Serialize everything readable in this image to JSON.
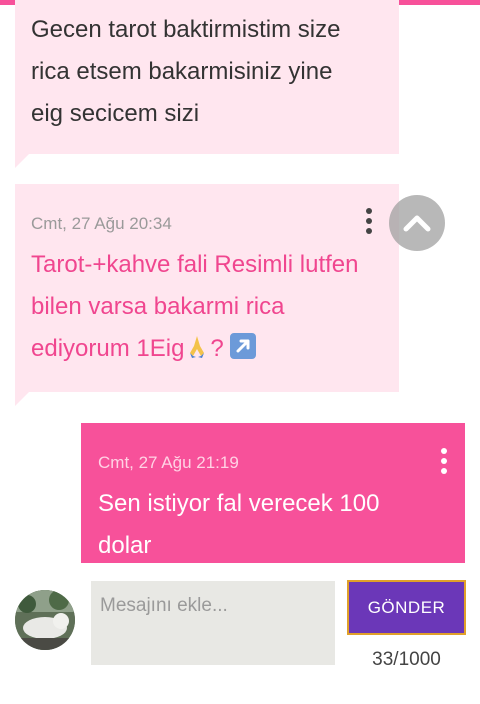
{
  "colors": {
    "accent": "#f7519a",
    "incoming_bg": "#ffe6ef",
    "send_button": "#6b37b8",
    "send_border": "#e0a02a"
  },
  "messages": [
    {
      "direction": "incoming",
      "text_lines": [
        "Gecen tarot baktirmistim size",
        "rica etsem bakarmisiniz yine",
        "eig secicem sizi"
      ]
    },
    {
      "direction": "incoming",
      "timestamp": "Cmt, 27 Ağu 20:34",
      "text_lines": [
        "Tarot-+kahve fali Resimli lutfen",
        "bilen varsa bakarmi rica",
        "ediyorum 1Eig"
      ],
      "emoji": [
        "folded-hands",
        "arrow-up-right"
      ],
      "text_after_emoji": "?"
    },
    {
      "direction": "outgoing",
      "timestamp": "Cmt, 27 Ağu 21:19",
      "text_lines": [
        "Sen istiyor fal verecek 100",
        "dolar"
      ]
    }
  ],
  "composer": {
    "placeholder": "Mesajını ekle...",
    "value": "",
    "send_label": "GÖNDER",
    "counter": "33/1000"
  },
  "icons": {
    "scroll_top": "chevron-up-icon",
    "menu": "more-vertical-icon"
  }
}
